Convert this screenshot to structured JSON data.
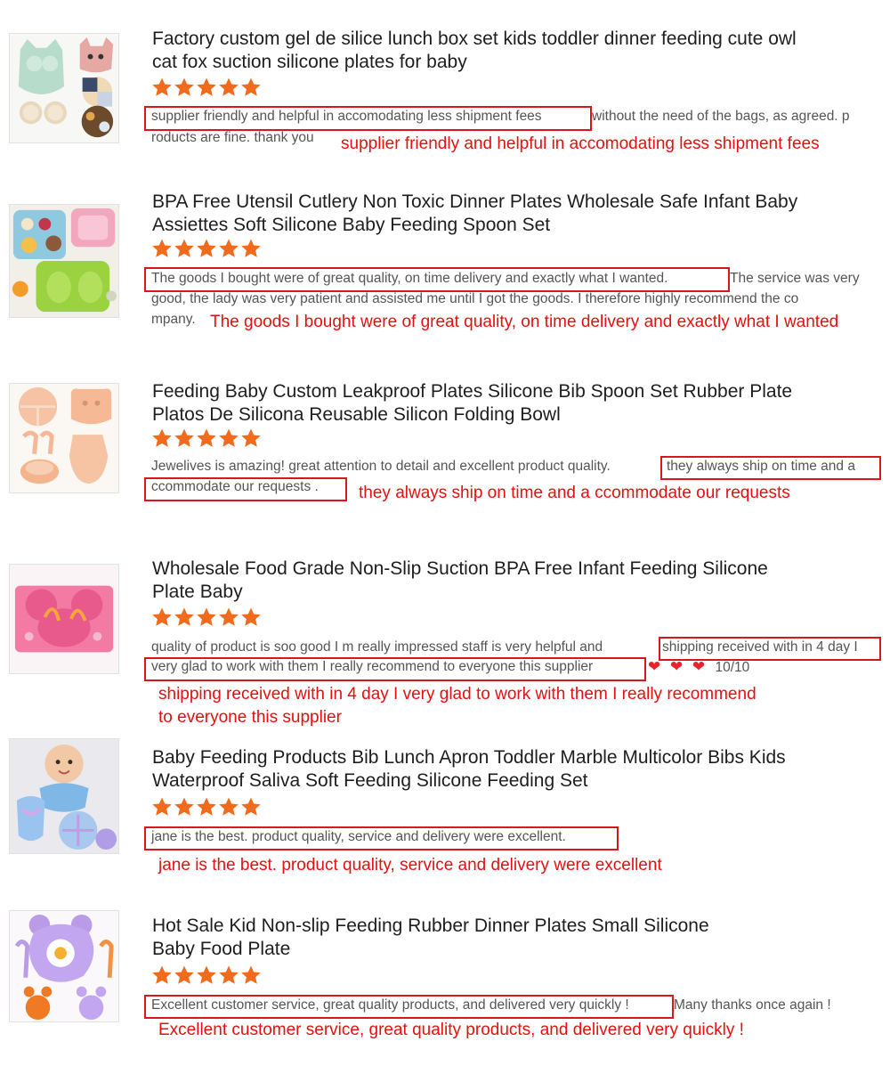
{
  "reviews": [
    {
      "title_lines": [
        "Factory custom gel de silice lunch box set kids toddler dinner feeding cute owl",
        "cat fox suction silicone plates for baby"
      ],
      "rating": 5,
      "text_highlight": "supplier friendly and helpful in accomodating less shipment fees",
      "text_rest_line1": " without the need of the bags, as agreed. p",
      "text_line2": "roducts are fine. thank you",
      "annotation": "supplier friendly and helpful in accomodating less shipment fees",
      "image_icon": "owl-cat-fox-plates-icon"
    },
    {
      "title_lines": [
        "BPA Free Utensil Cutlery Non Toxic Dinner Plates Wholesale Safe Infant Baby",
        "Assiettes Soft Silicone Baby Feeding Spoon Set"
      ],
      "rating": 5,
      "text_highlight": "The goods I bought were of great quality, on time delivery and exactly what I wanted.",
      "text_rest_line1": " The service was very",
      "text_line2": "good, the lady was very patient and assisted me until I got the goods. I therefore highly recommend the co",
      "text_line3": "mpany.",
      "annotation": "The goods I bought were of great quality, on time delivery and exactly what I wanted",
      "image_icon": "divided-plates-icon"
    },
    {
      "title_lines": [
        "Feeding Baby Custom Leakproof Plates Silicone Bib Spoon Set Rubber Plate",
        "Platos De Silicona Reusable Silicon Folding Bowl"
      ],
      "rating": 5,
      "text_line1_plain": "Jewelives is amazing! great attention to detail and excellent product quality.",
      "text_highlight_a": "they always ship on time and a",
      "text_highlight_b": "ccommodate our requests .",
      "annotation": "they always ship on time and a ccommodate our requests",
      "image_icon": "bib-bowl-spoon-set-icon"
    },
    {
      "title_lines": [
        "Wholesale Food Grade Non-Slip Suction BPA Free Infant Feeding Silicone",
        "Plate Baby"
      ],
      "rating": 5,
      "text_line1_plain": "quality of product is soo good I m really impressed staff is very helpful and",
      "text_highlight_a": "shipping received with in 4 day I",
      "text_highlight_b": "very glad to work with them I really recommend to everyone this supplier",
      "hearts": "❤ ❤ ❤",
      "score": "10/10",
      "annotation_lines": [
        "shipping received with in 4 day I very glad to work with them I really recommend",
        "to everyone this supplier"
      ],
      "image_icon": "mouse-plate-icon"
    },
    {
      "title_lines": [
        "Baby Feeding Products Bib Lunch Apron Toddler Marble Multicolor Bibs Kids",
        "Waterproof Saliva Soft Feeding Silicone Feeding Set"
      ],
      "rating": 5,
      "text_highlight": "jane is the best. product quality, service and delivery were excellent.",
      "annotation": "jane is the best. product quality, service and delivery were excellent",
      "image_icon": "baby-marble-bib-set-icon"
    },
    {
      "title_lines": [
        "Hot Sale Kid Non-slip Feeding Rubber Dinner Plates Small Silicone",
        "Baby Food Plate"
      ],
      "rating": 5,
      "text_highlight": "Excellent customer service, great quality products, and delivered very quickly !",
      "text_rest_line1": " Many thanks once again !",
      "annotation": "Excellent customer service, great quality products, and delivered very quickly !",
      "image_icon": "purple-orange-plates-icon"
    }
  ],
  "colors": {
    "star": "#f26a1b",
    "highlight_border": "#d9161c",
    "annotation": "#e60f0f",
    "title": "#1e1e1e",
    "review_text": "#555555"
  }
}
